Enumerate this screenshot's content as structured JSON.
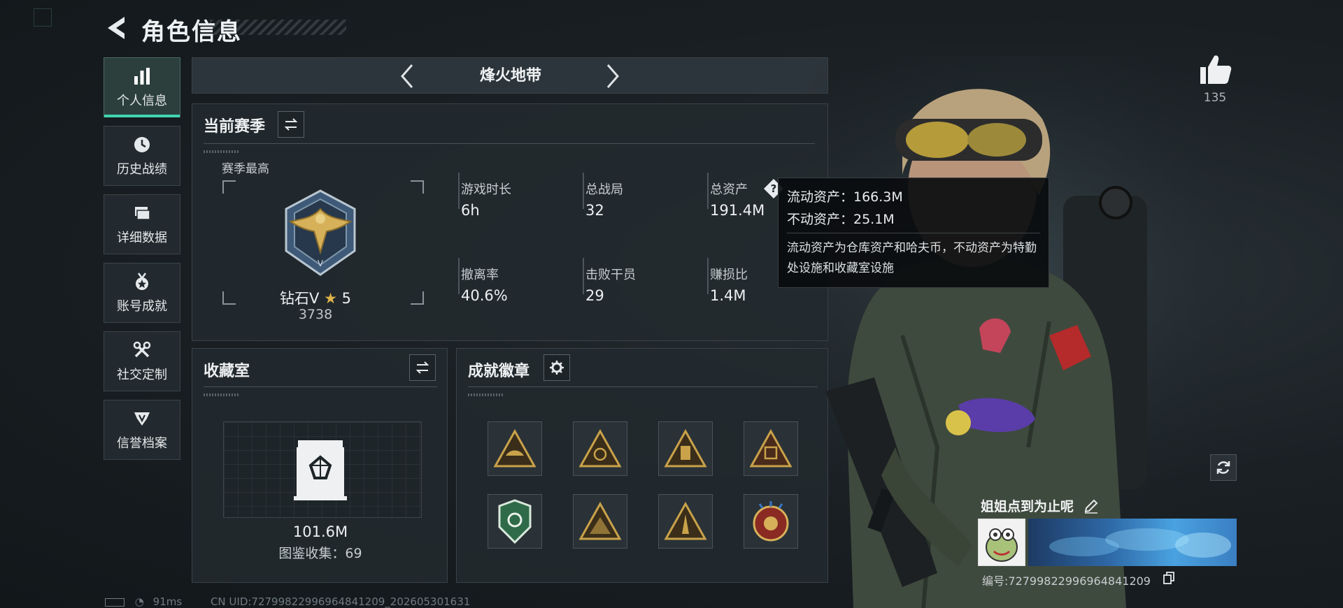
{
  "header": {
    "title": "角色信息"
  },
  "sidebar": {
    "items": [
      {
        "label": "个人信息",
        "icon": "bar-chart-icon",
        "active": true
      },
      {
        "label": "历史战绩",
        "icon": "clock-icon",
        "active": false
      },
      {
        "label": "详细数据",
        "icon": "folder-icon",
        "active": false
      },
      {
        "label": "账号成就",
        "icon": "medal-icon",
        "active": false
      },
      {
        "label": "社交定制",
        "icon": "tools-icon",
        "active": false
      },
      {
        "label": "信誉档案",
        "icon": "shield-icon",
        "active": false
      }
    ]
  },
  "mode": {
    "title": "烽火地带"
  },
  "season": {
    "title": "当前赛季",
    "best_label": "赛季最高",
    "rank_name": "钻石Ⅴ",
    "rank_star_glyph": "★",
    "rank_stars": "5",
    "rank_score": "3738",
    "stats": [
      {
        "label": "游戏时长",
        "value": "6h"
      },
      {
        "label": "总战局",
        "value": "32"
      },
      {
        "label": "总资产",
        "value": "191.4M"
      },
      {
        "label": "撤离率",
        "value": "40.6%"
      },
      {
        "label": "击败干员",
        "value": "29"
      },
      {
        "label": "赚损比",
        "value": "1.4M"
      }
    ]
  },
  "tooltip": {
    "liquid": "流动资产：166.3M",
    "fixed": "不动资产：25.1M",
    "desc": "流动资产为仓库资产和哈夫币，不动资产为特勤处设施和收藏室设施"
  },
  "collection": {
    "title": "收藏室",
    "value": "101.6M",
    "count_label": "图鉴收集：69"
  },
  "achievements": {
    "title": "成就徽章",
    "badges": [
      "triangle-badge-1",
      "triangle-badge-2",
      "triangle-badge-3",
      "triangle-badge-4",
      "shield-badge-green",
      "triangle-badge-5",
      "triangle-badge-6",
      "round-badge-red"
    ]
  },
  "profile": {
    "likes": "135",
    "nickname": "姐姐点到为止呢",
    "uid_label": "编号:727998229969648412​09"
  },
  "status_bar": {
    "ping": "91ms",
    "uid_text": "CN UID:727998229969648412​09_202605301631"
  },
  "colors": {
    "accent": "#3fd5b0",
    "panel": "#222a2f",
    "gold": "#c9a24a"
  }
}
